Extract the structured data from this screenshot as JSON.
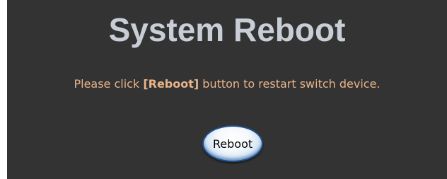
{
  "title": "System Reboot",
  "message": {
    "prefix": "Please click ",
    "keyword": "[Reboot]",
    "suffix": " button to restart switch device."
  },
  "reboot_button": {
    "label": "Reboot"
  },
  "colors": {
    "panel_background": "#333333",
    "title": "#c9cdd6",
    "message": "#e8b48a",
    "button_accent": "#3b74b5"
  }
}
